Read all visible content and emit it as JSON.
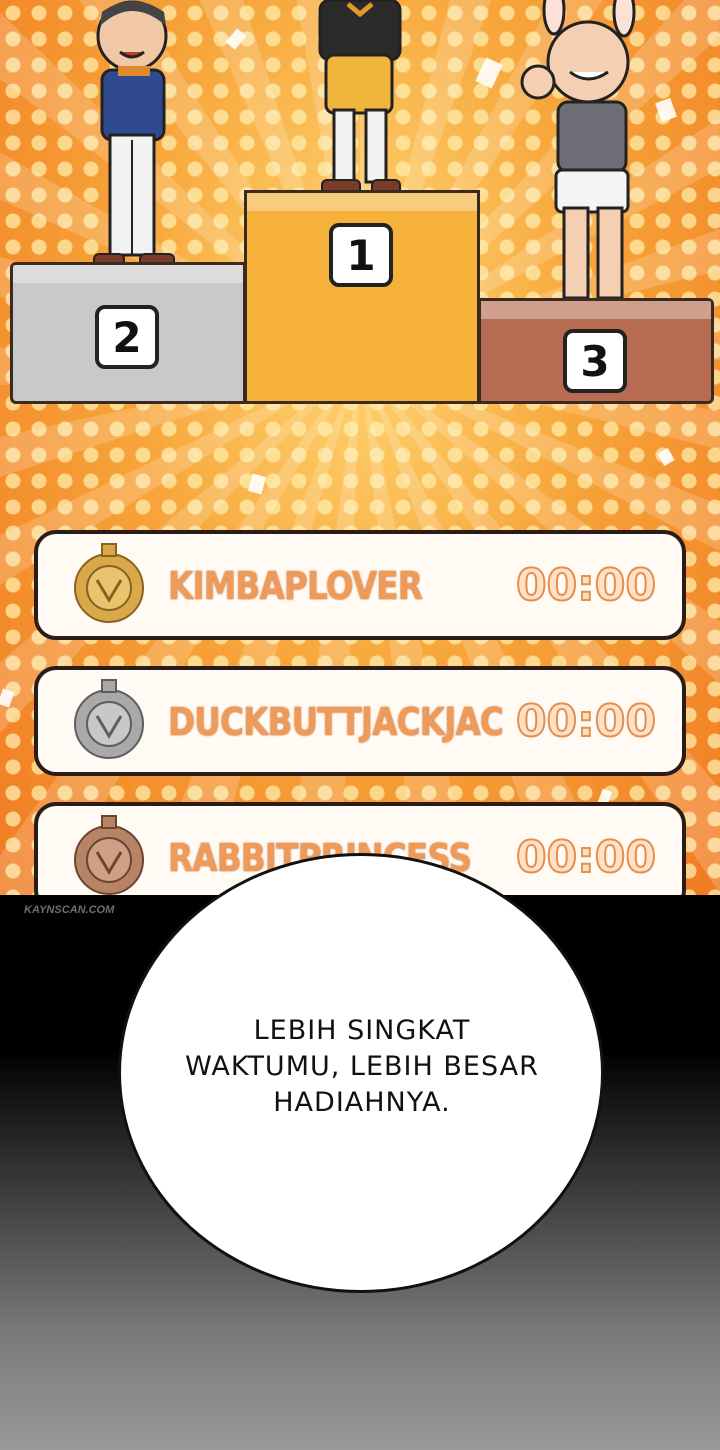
{
  "podium": {
    "second_label": "2",
    "first_label": "1",
    "third_label": "3"
  },
  "leaderboard": [
    {
      "name": "KIMBAPLOVER",
      "time": "00:00",
      "medal": "gold-medal-icon",
      "medal_color": "#d9a84a"
    },
    {
      "name": "DUCKBUTTJACKJAC",
      "time": "00:00",
      "medal": "silver-medal-icon",
      "medal_color": "#a9a9a9"
    },
    {
      "name": "RABBITPRINCESS",
      "time": "00:00",
      "medal": "bronze-medal-icon",
      "medal_color": "#b98466"
    }
  ],
  "watermark": "KAYNSCAN.COM",
  "speech_bubble": {
    "line1": "LEBIH SINGKAT",
    "line2": "WAKTUMU, LEBIH BESAR",
    "line3": "HADIAHNYA."
  },
  "colors": {
    "background_orange": "#f07a22",
    "podium_first": "#f5b13a",
    "podium_second": "#c9c9c9",
    "podium_third": "#b76b51",
    "rank_text": "#ee9a58"
  }
}
